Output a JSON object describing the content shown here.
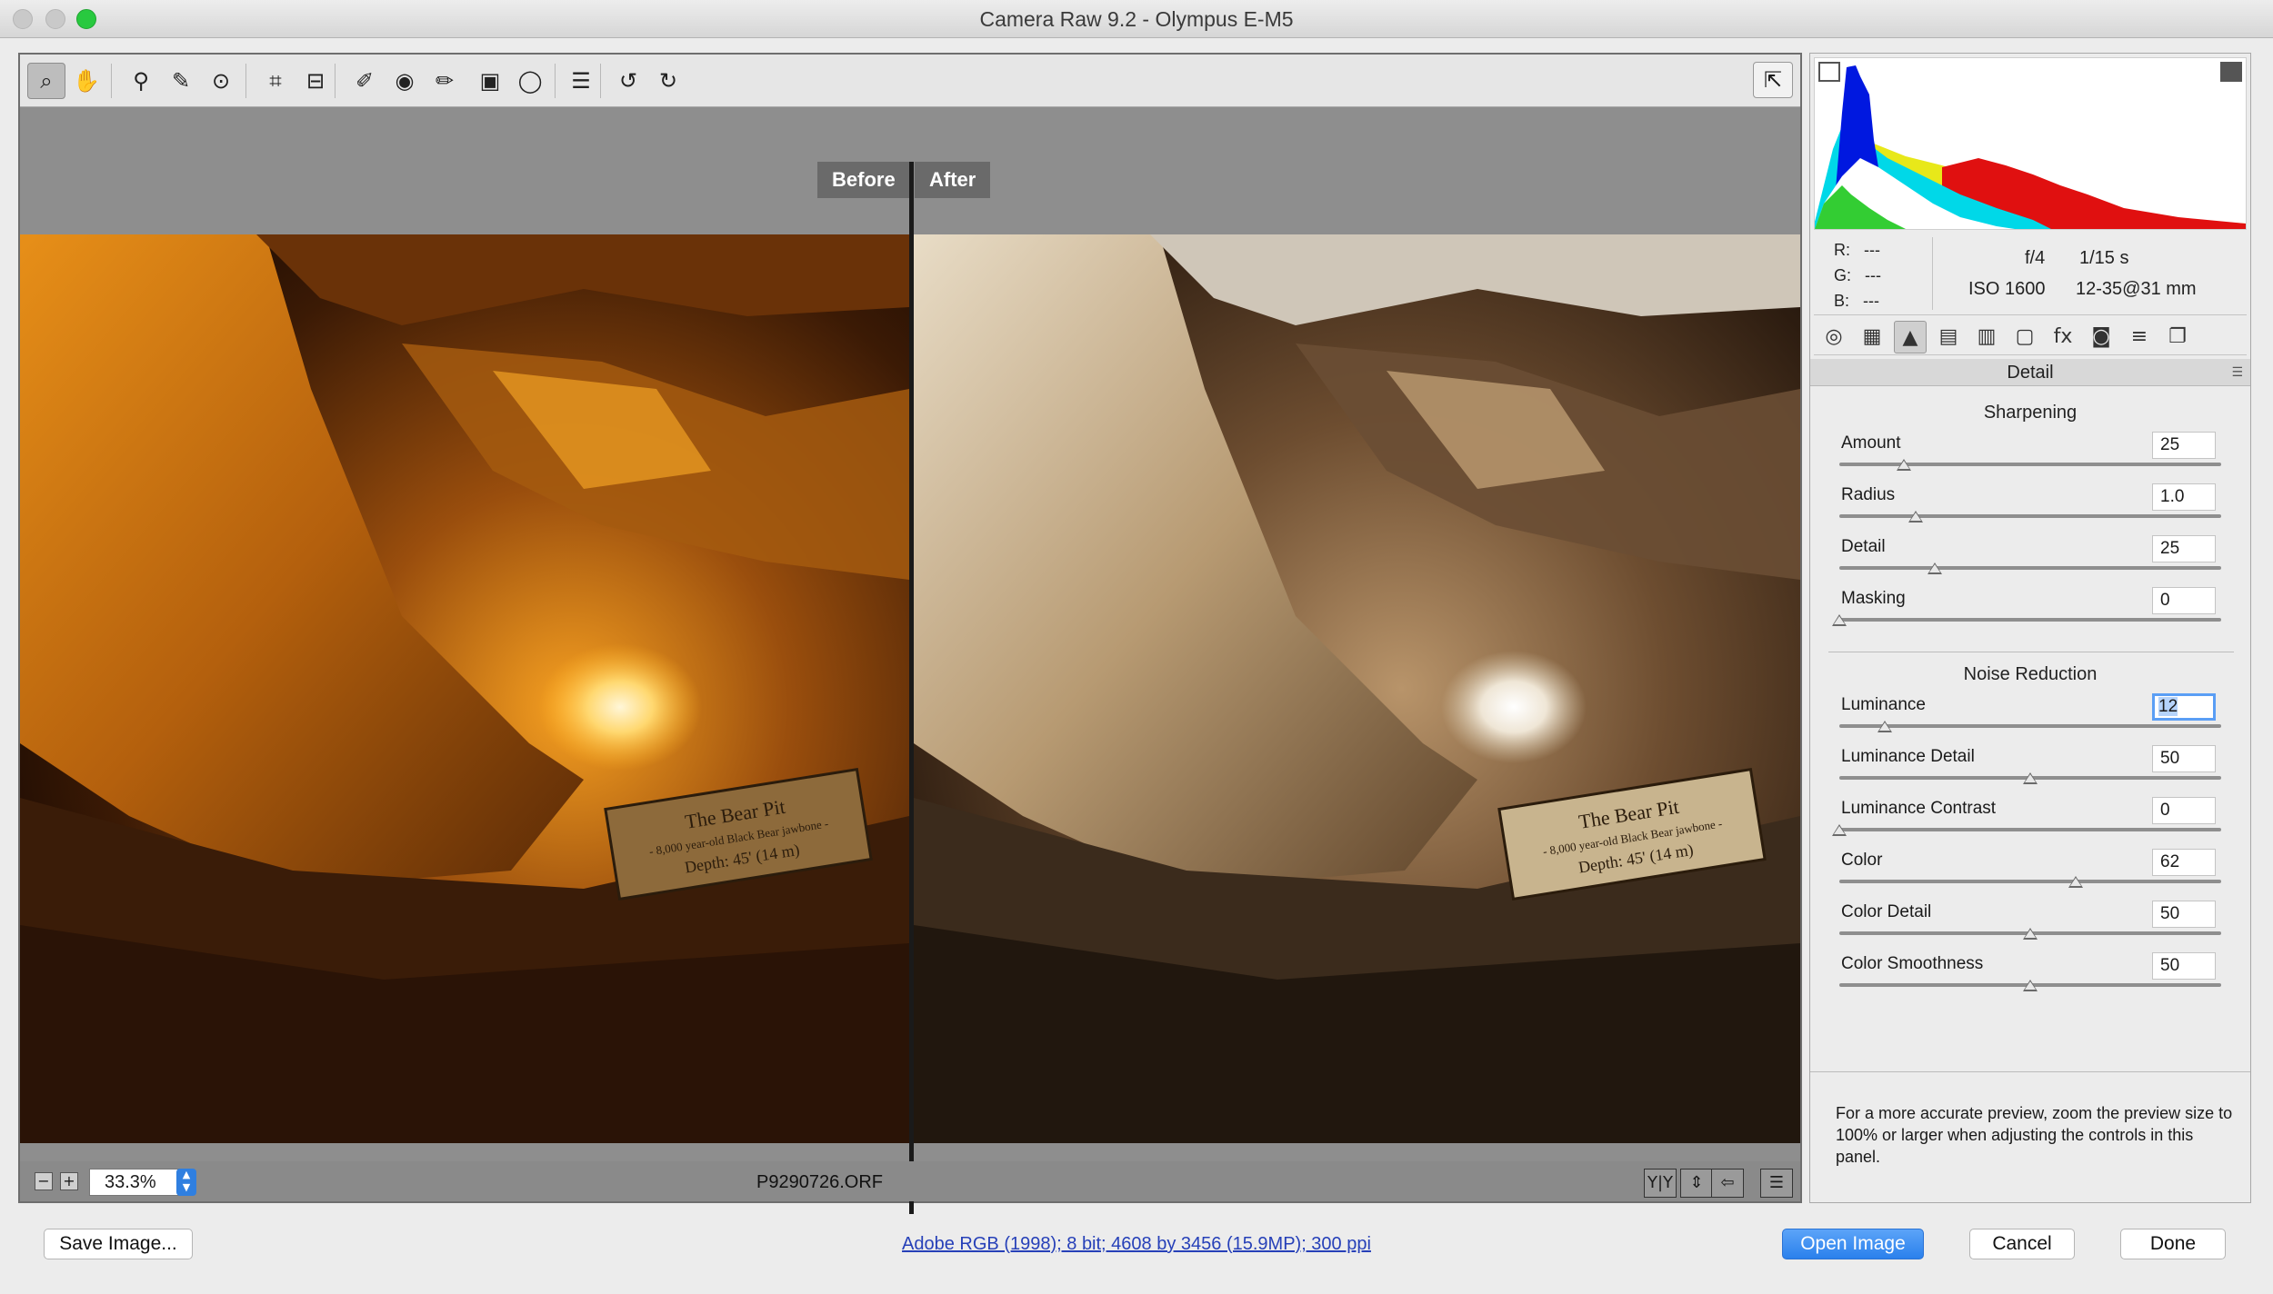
{
  "window": {
    "title": "Camera Raw 9.2  -  Olympus E-M5"
  },
  "toolbar": {
    "tools": [
      {
        "icon": "zoom-icon",
        "glyph": "⌕"
      },
      {
        "icon": "hand-icon",
        "glyph": "✋"
      },
      {
        "icon": "white-balance-icon",
        "glyph": "⚲"
      },
      {
        "icon": "color-sampler-icon",
        "glyph": "✎"
      },
      {
        "icon": "targeted-adjustment-icon",
        "glyph": "⊙"
      },
      {
        "icon": "crop-icon",
        "glyph": "⌗"
      },
      {
        "icon": "straighten-icon",
        "glyph": "⊟"
      },
      {
        "icon": "spot-removal-icon",
        "glyph": "✐"
      },
      {
        "icon": "red-eye-icon",
        "glyph": "◉"
      },
      {
        "icon": "adjustment-brush-icon",
        "glyph": "✏"
      },
      {
        "icon": "graduated-filter-icon",
        "glyph": "▣"
      },
      {
        "icon": "radial-filter-icon",
        "glyph": "◯"
      },
      {
        "icon": "preferences-icon",
        "glyph": "☰"
      },
      {
        "icon": "rotate-left-icon",
        "glyph": "↺"
      },
      {
        "icon": "rotate-right-icon",
        "glyph": "↻"
      }
    ],
    "exit_icon": "toggle-fullscreen-icon",
    "exit_glyph": "⇱"
  },
  "preview": {
    "before_label": "Before",
    "after_label": "After",
    "sign_line1": "The Bear Pit",
    "sign_line2": "- 8,000 year-old Black Bear jawbone -",
    "sign_line3": "Depth: 45' (14 m)"
  },
  "statusbar": {
    "zoom_minus": "−",
    "zoom_plus": "+",
    "zoom_value": "33.3%",
    "filename": "P9290726.ORF",
    "view_buttons": [
      "Y|Y",
      "⇕",
      "⇦",
      "☰"
    ]
  },
  "info": {
    "r_label": "R:",
    "r_value": "---",
    "g_label": "G:",
    "g_value": "---",
    "b_label": "B:",
    "b_value": "---",
    "aperture": "f/4",
    "shutter": "1/15 s",
    "iso": "ISO 1600",
    "lens": "12-35@31 mm"
  },
  "tabs": [
    {
      "icon": "basic-tab-icon",
      "glyph": "◎"
    },
    {
      "icon": "tone-curve-tab-icon",
      "glyph": "▦"
    },
    {
      "icon": "detail-tab-icon",
      "glyph": "▲"
    },
    {
      "icon": "hsl-tab-icon",
      "glyph": "▤"
    },
    {
      "icon": "split-toning-tab-icon",
      "glyph": "▥"
    },
    {
      "icon": "lens-corrections-tab-icon",
      "glyph": "▢"
    },
    {
      "icon": "effects-tab-icon",
      "glyph": "fx"
    },
    {
      "icon": "camera-calibration-tab-icon",
      "glyph": "◙"
    },
    {
      "icon": "presets-tab-icon",
      "glyph": "≡"
    },
    {
      "icon": "snapshots-tab-icon",
      "glyph": "❐"
    }
  ],
  "panel": {
    "title": "Detail",
    "menu_glyph": "☰",
    "sharpening_title": "Sharpening",
    "sharpening": [
      {
        "label": "Amount",
        "value": "25",
        "position": 0.17
      },
      {
        "label": "Radius",
        "value": "1.0",
        "position": 0.2
      },
      {
        "label": "Detail",
        "value": "25",
        "position": 0.25
      },
      {
        "label": "Masking",
        "value": "0",
        "position": 0.0
      }
    ],
    "noise_title": "Noise Reduction",
    "noise": [
      {
        "label": "Luminance",
        "value": "12",
        "position": 0.12
      },
      {
        "label": "Luminance Detail",
        "value": "50",
        "position": 0.5
      },
      {
        "label": "Luminance Contrast",
        "value": "0",
        "position": 0.0
      },
      {
        "label": "Color",
        "value": "62",
        "position": 0.62
      },
      {
        "label": "Color Detail",
        "value": "50",
        "position": 0.5
      },
      {
        "label": "Color Smoothness",
        "value": "50",
        "position": 0.5
      }
    ],
    "note": "For a more accurate preview, zoom the preview size to 100% or larger when adjusting the controls in this panel."
  },
  "bottom": {
    "save_label": "Save Image...",
    "workflow_link": "Adobe RGB (1998); 8 bit; 4608 by 3456 (15.9MP); 300 ppi",
    "open_label": "Open Image",
    "cancel_label": "Cancel",
    "done_label": "Done"
  }
}
